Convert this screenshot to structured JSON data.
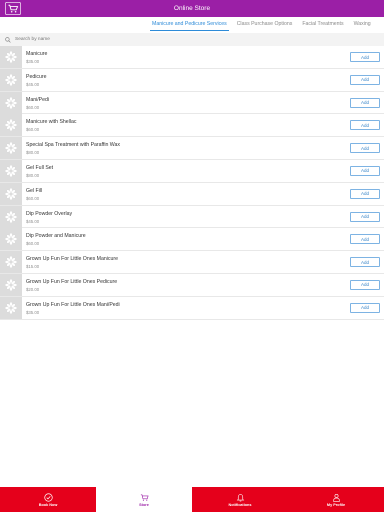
{
  "header": {
    "title": "Online Store"
  },
  "tabs": [
    {
      "label": "Manicure and Pedicure Services"
    },
    {
      "label": "Class Purchase Options"
    },
    {
      "label": "Facial Treatments"
    },
    {
      "label": "Waxing"
    }
  ],
  "search": {
    "placeholder": "Search by name"
  },
  "add_label": "Add",
  "items": [
    {
      "name": "Manicure",
      "price": "$35.00"
    },
    {
      "name": "Pedicure",
      "price": "$45.00"
    },
    {
      "name": "Mani/Pedi",
      "price": "$60.00"
    },
    {
      "name": "Manicure with Shellac",
      "price": "$60.00"
    },
    {
      "name": "Special Spa Treatment with Paraffin Wax",
      "price": "$80.00"
    },
    {
      "name": "Gel Full Set",
      "price": "$80.00"
    },
    {
      "name": "Gel Fill",
      "price": "$60.00"
    },
    {
      "name": "Dip Powder Overlay",
      "price": "$45.00"
    },
    {
      "name": "Dip Powder and Manicure",
      "price": "$60.00"
    },
    {
      "name": "Grown Up Fun For Little Ones Manicure",
      "price": "$15.00"
    },
    {
      "name": "Grown Up Fun For Little Ones Pedicure",
      "price": "$20.00"
    },
    {
      "name": "Grown Up Fun For Little Ones Mani/Pedi",
      "price": "$35.00"
    }
  ],
  "bottom_nav": [
    {
      "label": "Book Now",
      "icon": "check-circle-icon"
    },
    {
      "label": "Store",
      "icon": "cart-icon"
    },
    {
      "label": "Notifications",
      "icon": "bell-icon"
    },
    {
      "label": "My Profile",
      "icon": "person-icon"
    }
  ],
  "colors": {
    "header": "#9b1fa6",
    "bottom_bar": "#e5001b",
    "accent": "#2d8bd8"
  }
}
